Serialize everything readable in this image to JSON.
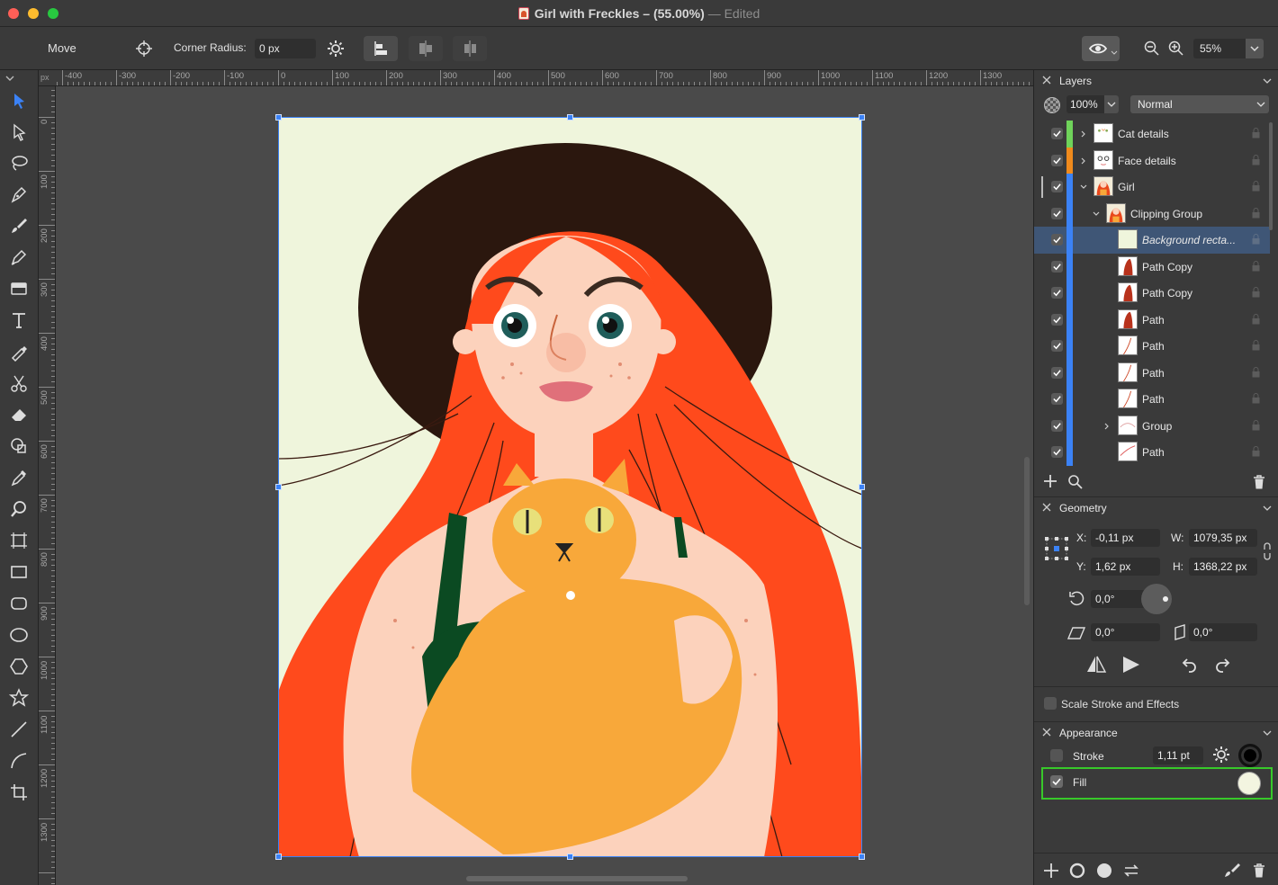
{
  "window": {
    "title": "Girl with Freckles – (55.00%)",
    "separator": "—",
    "status": "Edited"
  },
  "toolbar": {
    "tool_name": "Move",
    "corner_radius_label": "Corner Radius:",
    "corner_radius_value": "0 px",
    "zoom_value": "55%"
  },
  "tools": [
    "pointer-icon",
    "direct-select-icon",
    "lasso-icon",
    "pen-icon",
    "brush-icon",
    "pencil-icon",
    "gradient-icon",
    "text-icon",
    "eyedropper-pen-icon",
    "scissors-icon",
    "eraser-icon",
    "shape-builder-icon",
    "color-picker-icon",
    "zoom-icon",
    "artboard-icon",
    "rectangle-icon",
    "rounded-rectangle-icon",
    "ellipse-icon",
    "polygon-icon",
    "star-icon",
    "line-icon",
    "curve-icon",
    "crop-icon"
  ],
  "ruler": {
    "unit": "px",
    "h_labels": [
      "-400",
      "-300",
      "-200",
      "-100",
      "0",
      "100",
      "200",
      "300",
      "400",
      "500",
      "600",
      "700",
      "800",
      "900",
      "1000",
      "1100",
      "1200",
      "1300"
    ],
    "v_labels": [
      "0",
      "100",
      "200",
      "300",
      "400",
      "500",
      "600",
      "700",
      "800",
      "900",
      "1000",
      "1100",
      "1200",
      "1300"
    ]
  },
  "layers_panel": {
    "title": "Layers",
    "opacity": "100%",
    "blend_mode": "Normal",
    "rows": [
      {
        "name": "Cat details",
        "color": "#6fd35a",
        "indent": 0,
        "disclosure": "right",
        "italic": false,
        "selected": false,
        "thumb": "cat"
      },
      {
        "name": "Face details",
        "color": "#f08a1c",
        "indent": 0,
        "disclosure": "right",
        "italic": false,
        "selected": false,
        "thumb": "face"
      },
      {
        "name": "Girl",
        "color": "#3b82f6",
        "indent": 0,
        "disclosure": "down",
        "italic": false,
        "selected": false,
        "thumb": "girl"
      },
      {
        "name": "Clipping Group",
        "color": "#3b82f6",
        "indent": 1,
        "disclosure": "down",
        "italic": false,
        "selected": false,
        "thumb": "girl"
      },
      {
        "name": "Background recta...",
        "color": "#3b82f6",
        "indent": 2,
        "disclosure": "none",
        "italic": true,
        "selected": true,
        "thumb": "bg"
      },
      {
        "name": "Path Copy",
        "color": "#3b82f6",
        "indent": 2,
        "disclosure": "none",
        "italic": false,
        "selected": false,
        "thumb": "hair"
      },
      {
        "name": "Path Copy",
        "color": "#3b82f6",
        "indent": 2,
        "disclosure": "none",
        "italic": false,
        "selected": false,
        "thumb": "hair"
      },
      {
        "name": "Path",
        "color": "#3b82f6",
        "indent": 2,
        "disclosure": "none",
        "italic": false,
        "selected": false,
        "thumb": "hair"
      },
      {
        "name": "Path",
        "color": "#3b82f6",
        "indent": 2,
        "disclosure": "none",
        "italic": false,
        "selected": false,
        "thumb": "line"
      },
      {
        "name": "Path",
        "color": "#3b82f6",
        "indent": 2,
        "disclosure": "none",
        "italic": false,
        "selected": false,
        "thumb": "line"
      },
      {
        "name": "Path",
        "color": "#3b82f6",
        "indent": 2,
        "disclosure": "none",
        "italic": false,
        "selected": false,
        "thumb": "line"
      },
      {
        "name": "Group",
        "color": "#3b82f6",
        "indent": 2,
        "disclosure": "right",
        "italic": false,
        "selected": false,
        "thumb": "curve"
      },
      {
        "name": "Path",
        "color": "#3b82f6",
        "indent": 2,
        "disclosure": "none",
        "italic": false,
        "selected": false,
        "thumb": "line2"
      }
    ]
  },
  "geometry_panel": {
    "title": "Geometry",
    "x_label": "X:",
    "x_value": "-0,11 px",
    "y_label": "Y:",
    "y_value": "1,62 px",
    "w_label": "W:",
    "w_value": "1079,35 px",
    "h_label": "H:",
    "h_value": "1368,22 px",
    "rotation": "0,0°",
    "skew_h": "0,0°",
    "skew_v": "0,0°",
    "scale_stroke_label": "Scale Stroke and Effects"
  },
  "appearance_panel": {
    "title": "Appearance",
    "stroke_label": "Stroke",
    "stroke_width": "1,11 pt",
    "stroke_color": "#000000",
    "fill_label": "Fill",
    "fill_color": "#f3f5e0"
  },
  "artwork": {
    "background": "#eff5dc",
    "hair": "#ff4a1c",
    "hat": "#2b170e",
    "skin": "#fcd2bc",
    "cat": "#f8a83a",
    "dress": "#0b4a22",
    "accent_selection": "#3b82f6",
    "highlight_border": "#38c92a"
  }
}
